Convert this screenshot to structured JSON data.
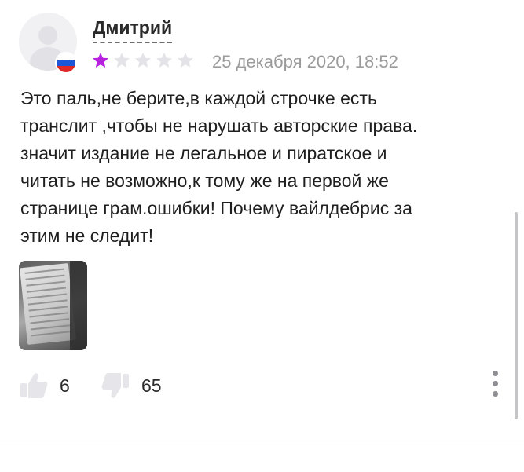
{
  "review": {
    "author": "Дмитрий",
    "rating": 1,
    "max_rating": 5,
    "date": "25 декабря 2020, 18:52",
    "text": "Это паль,не берите,в каждой строчке есть\nтранслит ,чтобы не нарушать авторские права.\nзначит издание не легальное и пиратское и\nчитать не возможно,к тому же на первой же\nстранице грам.ошибки! Почему вайлдебрис за\nэтим не следит!",
    "likes": "6",
    "dislikes": "65",
    "flag_colors": [
      "#ffffff",
      "#1c57d8",
      "#e02826"
    ]
  },
  "colors": {
    "star_filled": "#b620e0",
    "star_empty": "#e4e4e8",
    "thumb_icon": "#e6e6ea"
  },
  "icons": {
    "like": "thumbs-up-icon",
    "dislike": "thumbs-down-icon",
    "more": "more-vertical-icon"
  }
}
